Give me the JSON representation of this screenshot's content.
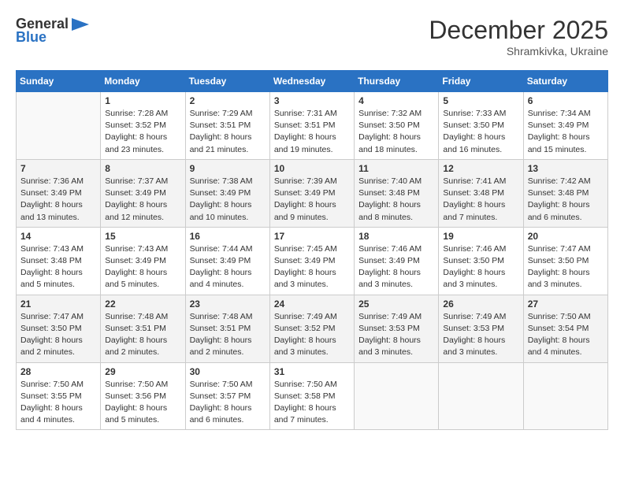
{
  "logo": {
    "general": "General",
    "blue": "Blue"
  },
  "title": "December 2025",
  "subtitle": "Shramkivka, Ukraine",
  "days_header": [
    "Sunday",
    "Monday",
    "Tuesday",
    "Wednesday",
    "Thursday",
    "Friday",
    "Saturday"
  ],
  "weeks": [
    [
      {
        "num": "",
        "detail": ""
      },
      {
        "num": "1",
        "detail": "Sunrise: 7:28 AM\nSunset: 3:52 PM\nDaylight: 8 hours\nand 23 minutes."
      },
      {
        "num": "2",
        "detail": "Sunrise: 7:29 AM\nSunset: 3:51 PM\nDaylight: 8 hours\nand 21 minutes."
      },
      {
        "num": "3",
        "detail": "Sunrise: 7:31 AM\nSunset: 3:51 PM\nDaylight: 8 hours\nand 19 minutes."
      },
      {
        "num": "4",
        "detail": "Sunrise: 7:32 AM\nSunset: 3:50 PM\nDaylight: 8 hours\nand 18 minutes."
      },
      {
        "num": "5",
        "detail": "Sunrise: 7:33 AM\nSunset: 3:50 PM\nDaylight: 8 hours\nand 16 minutes."
      },
      {
        "num": "6",
        "detail": "Sunrise: 7:34 AM\nSunset: 3:49 PM\nDaylight: 8 hours\nand 15 minutes."
      }
    ],
    [
      {
        "num": "7",
        "detail": "Sunrise: 7:36 AM\nSunset: 3:49 PM\nDaylight: 8 hours\nand 13 minutes."
      },
      {
        "num": "8",
        "detail": "Sunrise: 7:37 AM\nSunset: 3:49 PM\nDaylight: 8 hours\nand 12 minutes."
      },
      {
        "num": "9",
        "detail": "Sunrise: 7:38 AM\nSunset: 3:49 PM\nDaylight: 8 hours\nand 10 minutes."
      },
      {
        "num": "10",
        "detail": "Sunrise: 7:39 AM\nSunset: 3:49 PM\nDaylight: 8 hours\nand 9 minutes."
      },
      {
        "num": "11",
        "detail": "Sunrise: 7:40 AM\nSunset: 3:48 PM\nDaylight: 8 hours\nand 8 minutes."
      },
      {
        "num": "12",
        "detail": "Sunrise: 7:41 AM\nSunset: 3:48 PM\nDaylight: 8 hours\nand 7 minutes."
      },
      {
        "num": "13",
        "detail": "Sunrise: 7:42 AM\nSunset: 3:48 PM\nDaylight: 8 hours\nand 6 minutes."
      }
    ],
    [
      {
        "num": "14",
        "detail": "Sunrise: 7:43 AM\nSunset: 3:48 PM\nDaylight: 8 hours\nand 5 minutes."
      },
      {
        "num": "15",
        "detail": "Sunrise: 7:43 AM\nSunset: 3:49 PM\nDaylight: 8 hours\nand 5 minutes."
      },
      {
        "num": "16",
        "detail": "Sunrise: 7:44 AM\nSunset: 3:49 PM\nDaylight: 8 hours\nand 4 minutes."
      },
      {
        "num": "17",
        "detail": "Sunrise: 7:45 AM\nSunset: 3:49 PM\nDaylight: 8 hours\nand 3 minutes."
      },
      {
        "num": "18",
        "detail": "Sunrise: 7:46 AM\nSunset: 3:49 PM\nDaylight: 8 hours\nand 3 minutes."
      },
      {
        "num": "19",
        "detail": "Sunrise: 7:46 AM\nSunset: 3:50 PM\nDaylight: 8 hours\nand 3 minutes."
      },
      {
        "num": "20",
        "detail": "Sunrise: 7:47 AM\nSunset: 3:50 PM\nDaylight: 8 hours\nand 3 minutes."
      }
    ],
    [
      {
        "num": "21",
        "detail": "Sunrise: 7:47 AM\nSunset: 3:50 PM\nDaylight: 8 hours\nand 2 minutes."
      },
      {
        "num": "22",
        "detail": "Sunrise: 7:48 AM\nSunset: 3:51 PM\nDaylight: 8 hours\nand 2 minutes."
      },
      {
        "num": "23",
        "detail": "Sunrise: 7:48 AM\nSunset: 3:51 PM\nDaylight: 8 hours\nand 2 minutes."
      },
      {
        "num": "24",
        "detail": "Sunrise: 7:49 AM\nSunset: 3:52 PM\nDaylight: 8 hours\nand 3 minutes."
      },
      {
        "num": "25",
        "detail": "Sunrise: 7:49 AM\nSunset: 3:53 PM\nDaylight: 8 hours\nand 3 minutes."
      },
      {
        "num": "26",
        "detail": "Sunrise: 7:49 AM\nSunset: 3:53 PM\nDaylight: 8 hours\nand 3 minutes."
      },
      {
        "num": "27",
        "detail": "Sunrise: 7:50 AM\nSunset: 3:54 PM\nDaylight: 8 hours\nand 4 minutes."
      }
    ],
    [
      {
        "num": "28",
        "detail": "Sunrise: 7:50 AM\nSunset: 3:55 PM\nDaylight: 8 hours\nand 4 minutes."
      },
      {
        "num": "29",
        "detail": "Sunrise: 7:50 AM\nSunset: 3:56 PM\nDaylight: 8 hours\nand 5 minutes."
      },
      {
        "num": "30",
        "detail": "Sunrise: 7:50 AM\nSunset: 3:57 PM\nDaylight: 8 hours\nand 6 minutes."
      },
      {
        "num": "31",
        "detail": "Sunrise: 7:50 AM\nSunset: 3:58 PM\nDaylight: 8 hours\nand 7 minutes."
      },
      {
        "num": "",
        "detail": ""
      },
      {
        "num": "",
        "detail": ""
      },
      {
        "num": "",
        "detail": ""
      }
    ]
  ]
}
